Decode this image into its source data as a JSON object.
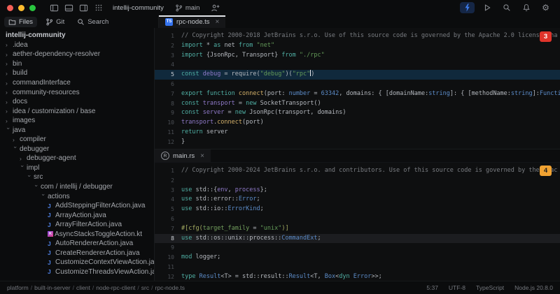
{
  "titlebar": {
    "project": "intellij-community",
    "branch": "main",
    "left_icons": [
      "window-close",
      "window-minimize",
      "window-zoom",
      "toggle-left-panel",
      "toggle-bottom-panel",
      "toggle-right-panel",
      "tool-windows-grid"
    ],
    "right_icons": [
      "ai-assistant-bolt",
      "run",
      "search-everywhere",
      "notifications-bell",
      "settings-gear"
    ],
    "accent_color": "#3574f0"
  },
  "navbar": {
    "items": [
      {
        "label": "Files",
        "icon": "folder-icon",
        "active": true
      },
      {
        "label": "Git",
        "icon": "git-branch-icon",
        "active": false
      },
      {
        "label": "Search",
        "icon": "search-icon",
        "active": false
      }
    ]
  },
  "tree": {
    "root": "intellij-community",
    "items": [
      {
        "label": ".idea",
        "depth": 1,
        "kind": "dir",
        "state": "collapsed"
      },
      {
        "label": "aether-dependency-resolver",
        "depth": 1,
        "kind": "dir",
        "state": "collapsed"
      },
      {
        "label": "bin",
        "depth": 1,
        "kind": "dir",
        "state": "collapsed"
      },
      {
        "label": "build",
        "depth": 1,
        "kind": "dir",
        "state": "collapsed"
      },
      {
        "label": "commandInterface",
        "depth": 1,
        "kind": "dir",
        "state": "collapsed"
      },
      {
        "label": "community-resources",
        "depth": 1,
        "kind": "dir",
        "state": "collapsed"
      },
      {
        "label": "docs",
        "depth": 1,
        "kind": "dir",
        "state": "collapsed"
      },
      {
        "label": "idea / customization / base",
        "depth": 1,
        "kind": "dir",
        "state": "collapsed"
      },
      {
        "label": "images",
        "depth": 1,
        "kind": "dir",
        "state": "collapsed"
      },
      {
        "label": "java",
        "depth": 1,
        "kind": "dir",
        "state": "expanded"
      },
      {
        "label": "compiler",
        "depth": 2,
        "kind": "dir",
        "state": "collapsed"
      },
      {
        "label": "debugger",
        "depth": 2,
        "kind": "dir",
        "state": "expanded"
      },
      {
        "label": "debugger-agent",
        "depth": 3,
        "kind": "dir",
        "state": "collapsed"
      },
      {
        "label": "impl",
        "depth": 3,
        "kind": "dir",
        "state": "expanded"
      },
      {
        "label": "src",
        "depth": 4,
        "kind": "dir",
        "state": "expanded"
      },
      {
        "label": "com / intellij / debugger",
        "depth": 5,
        "kind": "dir",
        "state": "expanded"
      },
      {
        "label": "actions",
        "depth": 6,
        "kind": "dir",
        "state": "expanded"
      },
      {
        "label": "AddSteppingFilterAction.java",
        "depth": 7,
        "kind": "file",
        "icon": "java"
      },
      {
        "label": "ArrayAction.java",
        "depth": 7,
        "kind": "file",
        "icon": "java"
      },
      {
        "label": "ArrayFilterAction.java",
        "depth": 7,
        "kind": "file",
        "icon": "java"
      },
      {
        "label": "AsyncStacksToggleAction.kt",
        "depth": 7,
        "kind": "file",
        "icon": "kotlin"
      },
      {
        "label": "AutoRendererAction.java",
        "depth": 7,
        "kind": "file",
        "icon": "java"
      },
      {
        "label": "CreateRendererAction.java",
        "depth": 7,
        "kind": "file",
        "icon": "java"
      },
      {
        "label": "CustomizeContextViewAction.java",
        "depth": 7,
        "kind": "file",
        "icon": "java"
      },
      {
        "label": "CustomizeThreadsViewAction.java",
        "depth": 7,
        "kind": "file",
        "icon": "java"
      }
    ]
  },
  "editors": [
    {
      "tab": {
        "label": "rpc-node.ts",
        "icon": "typescript-icon",
        "close": "×"
      },
      "badge": {
        "label": "3",
        "color": "#e0342b"
      },
      "active_line": 5,
      "lines": [
        {
          "n": 1,
          "t": [
            [
              "cmt",
              "// Copyright 2000-2018 JetBrains s.r.o. Use of this source code is governed by the Apache 2.0 license tha"
            ]
          ]
        },
        {
          "n": 2,
          "t": [
            [
              "kw",
              "import"
            ],
            [
              "txt",
              " * "
            ],
            [
              "kw",
              "as"
            ],
            [
              "txt",
              " net "
            ],
            [
              "kw",
              "from"
            ],
            [
              "txt",
              " "
            ],
            [
              "str",
              "\"net\""
            ]
          ]
        },
        {
          "n": 3,
          "t": [
            [
              "kw",
              "import"
            ],
            [
              "txt",
              " {JsonRpc, Transport} "
            ],
            [
              "kw",
              "from"
            ],
            [
              "txt",
              " "
            ],
            [
              "str",
              "\"./rpc\""
            ]
          ]
        },
        {
          "n": 4,
          "t": []
        },
        {
          "n": 5,
          "t": [
            [
              "kw",
              "const"
            ],
            [
              "txt",
              " "
            ],
            [
              "var",
              "debug"
            ],
            [
              "txt",
              " = require("
            ],
            [
              "str",
              "\"debug\""
            ],
            [
              "txt",
              ")("
            ],
            [
              "str",
              "\"rpc\""
            ],
            [
              "caret",
              ""
            ],
            [
              "txt",
              ")"
            ]
          ]
        },
        {
          "n": 6,
          "t": []
        },
        {
          "n": 7,
          "t": [
            [
              "kw",
              "export"
            ],
            [
              "txt",
              " "
            ],
            [
              "kw",
              "function"
            ],
            [
              "txt",
              " "
            ],
            [
              "fn",
              "connect"
            ],
            [
              "txt",
              "(port: "
            ],
            [
              "typ",
              "number"
            ],
            [
              "txt",
              " = "
            ],
            [
              "num",
              "63342"
            ],
            [
              "txt",
              ", domains: { [domainName:"
            ],
            [
              "typ",
              "string"
            ],
            [
              "txt",
              "]: { [methodName:"
            ],
            [
              "typ",
              "string"
            ],
            [
              "txt",
              "]:"
            ],
            [
              "typ",
              "Function"
            ],
            [
              "txt",
              "; }"
            ]
          ]
        },
        {
          "n": 8,
          "t": [
            [
              "txt",
              "  "
            ],
            [
              "kw",
              "const"
            ],
            [
              "txt",
              " "
            ],
            [
              "var",
              "transport"
            ],
            [
              "txt",
              " = "
            ],
            [
              "kw",
              "new"
            ],
            [
              "txt",
              " SocketTransport()"
            ]
          ]
        },
        {
          "n": 9,
          "t": [
            [
              "txt",
              "  "
            ],
            [
              "kw",
              "const"
            ],
            [
              "txt",
              " "
            ],
            [
              "var",
              "server"
            ],
            [
              "txt",
              " = "
            ],
            [
              "kw",
              "new"
            ],
            [
              "txt",
              " JsonRpc(transport, domains)"
            ]
          ]
        },
        {
          "n": 10,
          "t": [
            [
              "txt",
              "  "
            ],
            [
              "var",
              "transport"
            ],
            [
              "txt",
              "."
            ],
            [
              "fn",
              "connect"
            ],
            [
              "txt",
              "(port)"
            ]
          ]
        },
        {
          "n": 11,
          "t": [
            [
              "txt",
              "  "
            ],
            [
              "kw",
              "return"
            ],
            [
              "txt",
              " server"
            ]
          ]
        },
        {
          "n": 12,
          "t": [
            [
              "txt",
              "}"
            ]
          ]
        }
      ]
    },
    {
      "tab": {
        "label": "main.rs",
        "icon": "rust-icon",
        "close": "×"
      },
      "badge": {
        "label": "4",
        "color": "#f0a232"
      },
      "active_line": 8,
      "lines": [
        {
          "n": 1,
          "t": [
            [
              "cmt",
              "// Copyright 2000-2024 JetBrains s.r.o. and contributors. Use of this source code is governed by the Apac"
            ]
          ]
        },
        {
          "n": 2,
          "t": []
        },
        {
          "n": 3,
          "t": [
            [
              "kw",
              "use"
            ],
            [
              "txt",
              " std::{"
            ],
            [
              "var",
              "env"
            ],
            [
              "txt",
              ", "
            ],
            [
              "var",
              "process"
            ],
            [
              "txt",
              "};"
            ]
          ]
        },
        {
          "n": 4,
          "t": [
            [
              "kw",
              "use"
            ],
            [
              "txt",
              " std::error::"
            ],
            [
              "typ",
              "Error"
            ],
            [
              "txt",
              ";"
            ]
          ]
        },
        {
          "n": 5,
          "t": [
            [
              "kw",
              "use"
            ],
            [
              "txt",
              " std::io::"
            ],
            [
              "typ",
              "ErrorKind"
            ],
            [
              "txt",
              ";"
            ]
          ]
        },
        {
          "n": 6,
          "t": []
        },
        {
          "n": 7,
          "t": [
            [
              "attr",
              "#[cfg("
            ],
            [
              "attr2",
              "target_family"
            ],
            [
              "txt",
              " = "
            ],
            [
              "str",
              "\"unix\""
            ],
            [
              "attr",
              ")]"
            ]
          ]
        },
        {
          "n": 8,
          "t": [
            [
              "kw",
              "use"
            ],
            [
              "txt",
              " std::os::unix::process::"
            ],
            [
              "typ",
              "CommandExt"
            ],
            [
              "txt",
              ";"
            ]
          ]
        },
        {
          "n": 9,
          "t": []
        },
        {
          "n": 10,
          "t": [
            [
              "kw",
              "mod"
            ],
            [
              "txt",
              " logger;"
            ]
          ]
        },
        {
          "n": 11,
          "t": []
        },
        {
          "n": 12,
          "t": [
            [
              "kw",
              "type"
            ],
            [
              "txt",
              " "
            ],
            [
              "typ",
              "Result"
            ],
            [
              "txt",
              "<T> = std::result::"
            ],
            [
              "typ",
              "Result"
            ],
            [
              "txt",
              "<T, "
            ],
            [
              "typ",
              "Box"
            ],
            [
              "txt",
              "<"
            ],
            [
              "kw",
              "dyn"
            ],
            [
              "txt",
              " "
            ],
            [
              "typ",
              "Error"
            ],
            [
              "txt",
              ">>;"
            ]
          ]
        }
      ]
    }
  ],
  "statusbar": {
    "breadcrumbs": [
      "platform",
      "built-in-server",
      "client",
      "node-rpc-client",
      "src",
      "rpc-node.ts"
    ],
    "right": [
      {
        "name": "cursor-position",
        "label": "5:37"
      },
      {
        "name": "encoding",
        "label": "UTF-8"
      },
      {
        "name": "language",
        "label": "TypeScript"
      },
      {
        "name": "runtime-version",
        "label": "Node.js 20.8.0"
      }
    ]
  },
  "colors": {
    "accent": "#3574f0",
    "badge_red": "#e0342b",
    "badge_orange": "#f0a232",
    "caret_row_ts": "#10293c",
    "java_icon": "#4d7fe0",
    "kotlin_icon": "#8a4be8"
  }
}
